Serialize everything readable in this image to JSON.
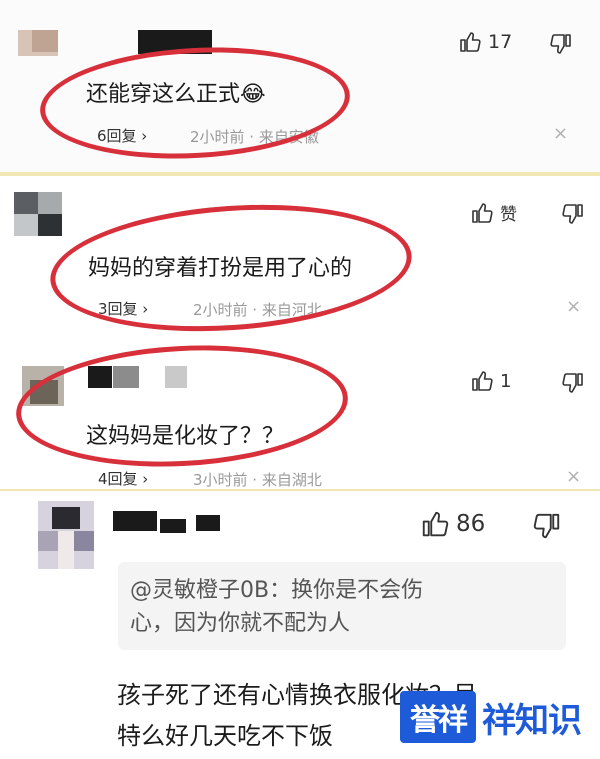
{
  "comments": [
    {
      "likes": "17",
      "text": "还能穿这么正式",
      "emoji": "😂",
      "replies": "6回复 ›",
      "meta": "2小时前 · 来自安徽"
    },
    {
      "likes": "赞",
      "text": "妈妈的穿着打扮是用了心的",
      "replies": "3回复 ›",
      "meta": "2小时前 · 来自河北"
    },
    {
      "likes": "1",
      "text": "这妈妈是化妆了？？",
      "replies": "4回复 ›",
      "meta": "3小时前 · 来自湖北"
    },
    {
      "likes": "86",
      "quote_line1": "@灵敏橙子0B：换你是不会伤",
      "quote_line2": "心，因为你就不配为人",
      "text_line1": "孩子死了还有心情换衣服化妆？呆",
      "text_line2": "特么好几天吃不下饭"
    }
  ],
  "close_glyph": "×",
  "watermark": {
    "logo": "誉祥",
    "text": "祥知识"
  },
  "colors": {
    "annotation_red": "#d7303a",
    "watermark_blue": "#1d5bd8",
    "meta_gray": "#9a9a9a"
  }
}
